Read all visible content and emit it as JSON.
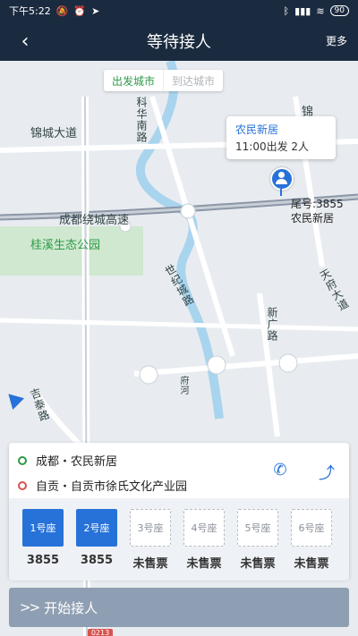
{
  "status_bar": {
    "time": "下午5:22",
    "battery": "90"
  },
  "header": {
    "back_icon": "chevron-left-icon",
    "title": "等待接人",
    "more_label": "更多"
  },
  "city_tabs": {
    "departure": "出发城市",
    "arrival": "到达城市"
  },
  "map": {
    "labels": {
      "jincheng_road": "锦城大道",
      "ring_expressway": "成都绕城高速",
      "guixi_park": "桂溪生态公园",
      "river_road": "科华南路",
      "century_city_road": "世纪城路",
      "jifeng_road": "吉泰路",
      "xingang_road": "新广路",
      "east_road": "天府大道",
      "fuhe": "府河",
      "jin": "锦"
    },
    "popup": {
      "place": "农民新居",
      "info": "11:00出发  2人"
    },
    "tail_number": "尾号:3855",
    "tail_place": "农民新居",
    "pin_icon": "person-pin-icon",
    "locator_icon": "location-arrow-icon",
    "bottom_tag": "0213"
  },
  "route": {
    "origin": "成都・农民新居",
    "destination": "自贡・自贡市徐氏文化产业园",
    "phone_icon": "phone-icon",
    "navigate_icon": "navigate-icon"
  },
  "seats": [
    {
      "label": "1号座",
      "status": "3855",
      "sold": true
    },
    {
      "label": "2号座",
      "status": "3855",
      "sold": true
    },
    {
      "label": "3号座",
      "status": "未售票",
      "sold": false
    },
    {
      "label": "4号座",
      "status": "未售票",
      "sold": false
    },
    {
      "label": "5号座",
      "status": "未售票",
      "sold": false
    },
    {
      "label": "6号座",
      "status": "未售票",
      "sold": false
    }
  ],
  "start_button": {
    "label": "开始接人",
    "icon": "double-chevron-right-icon"
  },
  "colors": {
    "header_bg": "#1a2a3f",
    "accent_blue": "#2672d9",
    "accent_green": "#2e9a48",
    "button_disabled": "#8f9fb3"
  }
}
